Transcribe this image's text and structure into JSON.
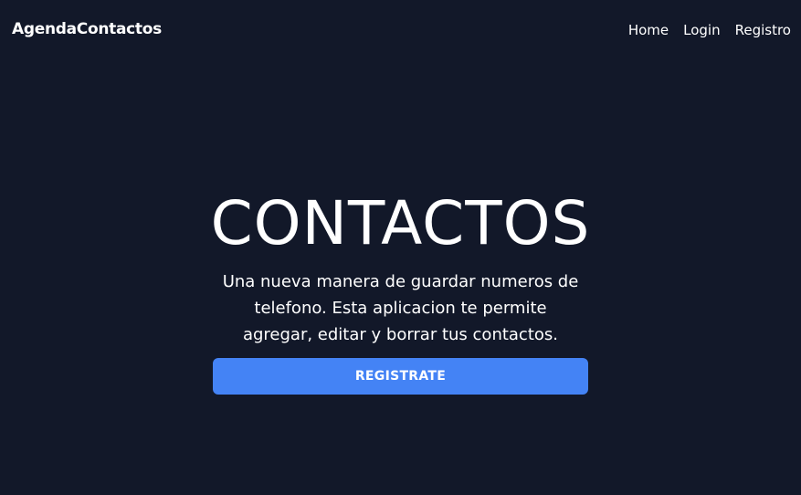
{
  "navbar": {
    "brand": "AgendaContactos",
    "links": [
      {
        "label": "Home"
      },
      {
        "label": "Login"
      },
      {
        "label": "Registro"
      }
    ]
  },
  "hero": {
    "title": "CONTACTOS",
    "description": "Una nueva manera de guardar numeros de telefono. Esta aplicacion te permite agregar, editar y borrar tus contactos.",
    "cta_label": "REGISTRATE"
  },
  "colors": {
    "background": "#121829",
    "text": "#ffffff",
    "accent": "#4483f5"
  }
}
